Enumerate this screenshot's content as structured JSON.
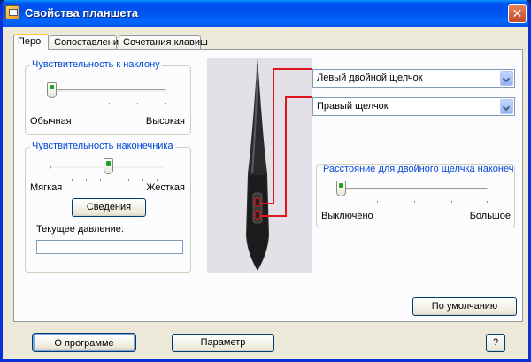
{
  "window": {
    "title": "Свойства планшета",
    "close_glyph": "✕"
  },
  "tabs": [
    {
      "label": "Перо",
      "active": true
    },
    {
      "label": "Сопоставление",
      "active": false
    },
    {
      "label": "Сочетания клавиш",
      "active": false
    }
  ],
  "tilt": {
    "title": "Чувствительность к наклону",
    "min_label": "Обычная",
    "max_label": "Высокая",
    "level_fraction": 0.0
  },
  "tip": {
    "title": "Чувствительность наконечника",
    "min_label": "Мягкая",
    "max_label": "Жесткая",
    "level_fraction": 0.5,
    "details_button": "Сведения",
    "pressure_label": "Текущее давление:",
    "pressure_value": ""
  },
  "pen_buttons": {
    "upper": "Левый двойной щелчок",
    "lower": "Правый щелчок"
  },
  "double_click": {
    "title": "Расстояние для двойного щелчка наконечника",
    "min_label": "Выключено",
    "max_label": "Большое",
    "level_fraction": 0.0
  },
  "buttons": {
    "defaults": "По умолчанию",
    "about": "О программе",
    "options": "Параметр",
    "help": "?"
  },
  "colors": {
    "titlebar": "#0055e5",
    "group_title": "#0046d5",
    "callout_line": "#e0161b",
    "slider_thumb_mark": "#21a121"
  }
}
